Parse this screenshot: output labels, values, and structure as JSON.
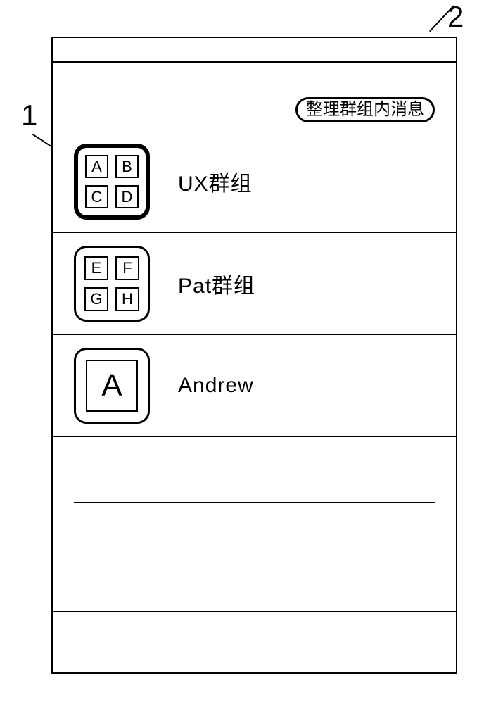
{
  "callouts": {
    "one": "1",
    "two": "2"
  },
  "header": {
    "organize_button": "整理群组内消息"
  },
  "chats": [
    {
      "name": "UX群组",
      "type": "group",
      "avatar_letters": [
        "A",
        "B",
        "C",
        "D"
      ],
      "highlighted": true
    },
    {
      "name": "Pat群组",
      "type": "group",
      "avatar_letters": [
        "E",
        "F",
        "G",
        "H"
      ],
      "highlighted": false
    },
    {
      "name": "Andrew",
      "type": "single",
      "avatar_letters": [
        "A"
      ],
      "highlighted": false
    }
  ]
}
